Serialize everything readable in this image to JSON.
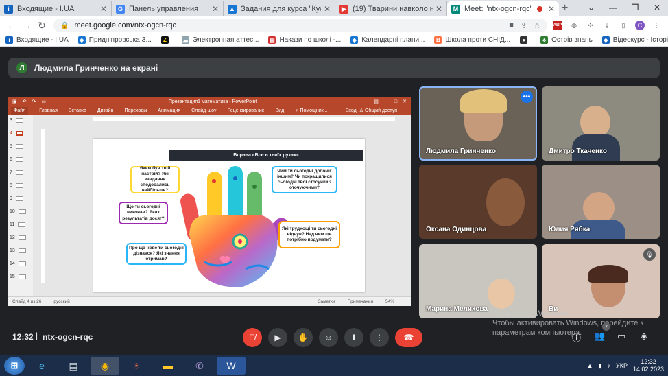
{
  "browser": {
    "tabs": [
      {
        "title": "Входящие - I.UA",
        "icon_color": "#1565c0",
        "icon_letter": "i"
      },
      {
        "title": "Панель управления",
        "icon_color": "#4285f4",
        "icon_letter": "G"
      },
      {
        "title": "Задания для курса \"Культура",
        "icon_color": "#1976d2",
        "icon_letter": "▲"
      },
      {
        "title": "(19) Тварини навколо нас - Yo",
        "icon_color": "#e53935",
        "icon_letter": "▶"
      },
      {
        "title": "Meet: \"ntx-ogcn-rqc\"",
        "icon_color": "#00897b",
        "icon_letter": "M"
      }
    ],
    "new_tab": "+",
    "url": "meet.google.com/ntx-ogcn-rqc",
    "profile_letter": "C",
    "bookmarks": [
      {
        "label": "Входящие - I.UA",
        "icon_color": "#1565c0"
      },
      {
        "label": "Придніпровська З...",
        "icon_color": "#1976d2"
      },
      {
        "label": "",
        "icon_color": "#111111"
      },
      {
        "label": "Электронная аттес...",
        "icon_color": "#90a4ae"
      },
      {
        "label": "Накази по школі -...",
        "icon_color": "#d32f2f"
      },
      {
        "label": "Календарні плани...",
        "icon_color": "#1976d2"
      },
      {
        "label": "Школа проти СНІД...",
        "icon_color": "#ff7043"
      },
      {
        "label": "",
        "icon_color": "#333333"
      },
      {
        "label": "Острів знань",
        "icon_color": "#2e7d32"
      },
      {
        "label": "Відеокурс - Історія...",
        "icon_color": "#1565c0"
      }
    ]
  },
  "meet": {
    "banner_avatar": "Л",
    "banner_text": "Людмила Гринченко на екрані",
    "presentation": {
      "window_title": "Презентация1 математика - PowerPoint",
      "ribbon_tabs": [
        "Файл",
        "Главная",
        "Вставка",
        "Дизайн",
        "Переходы",
        "Анимация",
        "Слайд-шоу",
        "Рецензирование",
        "Вид",
        "Помощник..."
      ],
      "sign_in": "Вход",
      "share": "Общий доступ",
      "thumbs": [
        "3",
        "4",
        "5",
        "6",
        "7",
        "8",
        "9",
        "10",
        "11",
        "12",
        "13",
        "14",
        "15"
      ],
      "selected_thumb": "4",
      "slide_title": "Вправа «Все в твоїх руках»",
      "bubbles": {
        "mood": "Яким був твій настрій? Які завдання сподобались найбільше?",
        "help": "Чим ти сьогодні допоміг іншим? Чи покращилися сьогодні твої стосунки з оточуючими?",
        "done": "Що ти сьогодні виконав? Яких результатів досяг?",
        "difficulty": "Які труднощі ти сьогодні відчув? Над чим ще потрібно подумати?",
        "new": "Про що нове ти сьогодні дізнався? Які знання отримав?"
      },
      "status_slide": "Слайд 4 из 26",
      "status_lang": "русский",
      "status_notes": "Заметки",
      "status_comments": "Примечания",
      "status_zoom": "54%"
    },
    "participants": [
      {
        "name": "Людмила Гринченко",
        "bg": "#6a6257"
      },
      {
        "name": "Дмитро Ткаченко",
        "bg": "#8d8a80"
      },
      {
        "name": "Оксана Одинцова",
        "bg": "#5a3a2a"
      },
      {
        "name": "Юлия Рябка",
        "bg": "#9c8f86"
      },
      {
        "name": "Марина Мелихова",
        "bg": "#c9c6bf"
      },
      {
        "name": "Ви",
        "bg": "#d8c4b8"
      }
    ],
    "more_options": "•••",
    "time": "12:32",
    "separator": "|",
    "meeting_code": "ntx-ogcn-rqc",
    "activate_line1": "Активация Windows",
    "activate_line2": "Чтобы активировать Windows, перейдите к",
    "activate_line3": "параметрам компьютера.",
    "people_count": "7"
  },
  "taskbar": {
    "lang": "УКР",
    "clock_time": "12:32",
    "clock_date": "14.02.2023"
  }
}
